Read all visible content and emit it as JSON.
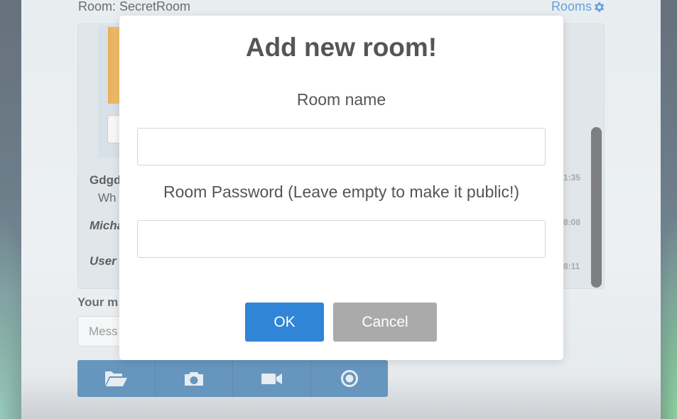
{
  "background": {
    "room_title": "Room: SecretRoom",
    "rooms_link": "Rooms",
    "rooms_icon": "gear-icon",
    "messages": [
      {
        "author": "Gdgd",
        "text": "Wh",
        "time": "1:35",
        "italic": false
      },
      {
        "author": "Micha",
        "text": "",
        "time": "8:08",
        "italic": true
      },
      {
        "author": "User",
        "text": "",
        "time": "8:11",
        "italic": true
      }
    ],
    "your_message_label": "Your m",
    "message_placeholder": "Mess",
    "toolbar_icons": [
      "folder-open-icon",
      "camera-icon",
      "video-camera-icon",
      "record-icon"
    ]
  },
  "modal": {
    "title": "Add new room!",
    "room_name_label": "Room name",
    "room_name_value": "",
    "password_label": "Room Password (Leave empty to make it public!)",
    "password_value": "",
    "ok_label": "OK",
    "cancel_label": "Cancel"
  },
  "colors": {
    "ok_button": "#3085d6",
    "cancel_button": "#aaaaaa",
    "toolbar": "#2c6ea6",
    "link": "#2b7bd0"
  }
}
